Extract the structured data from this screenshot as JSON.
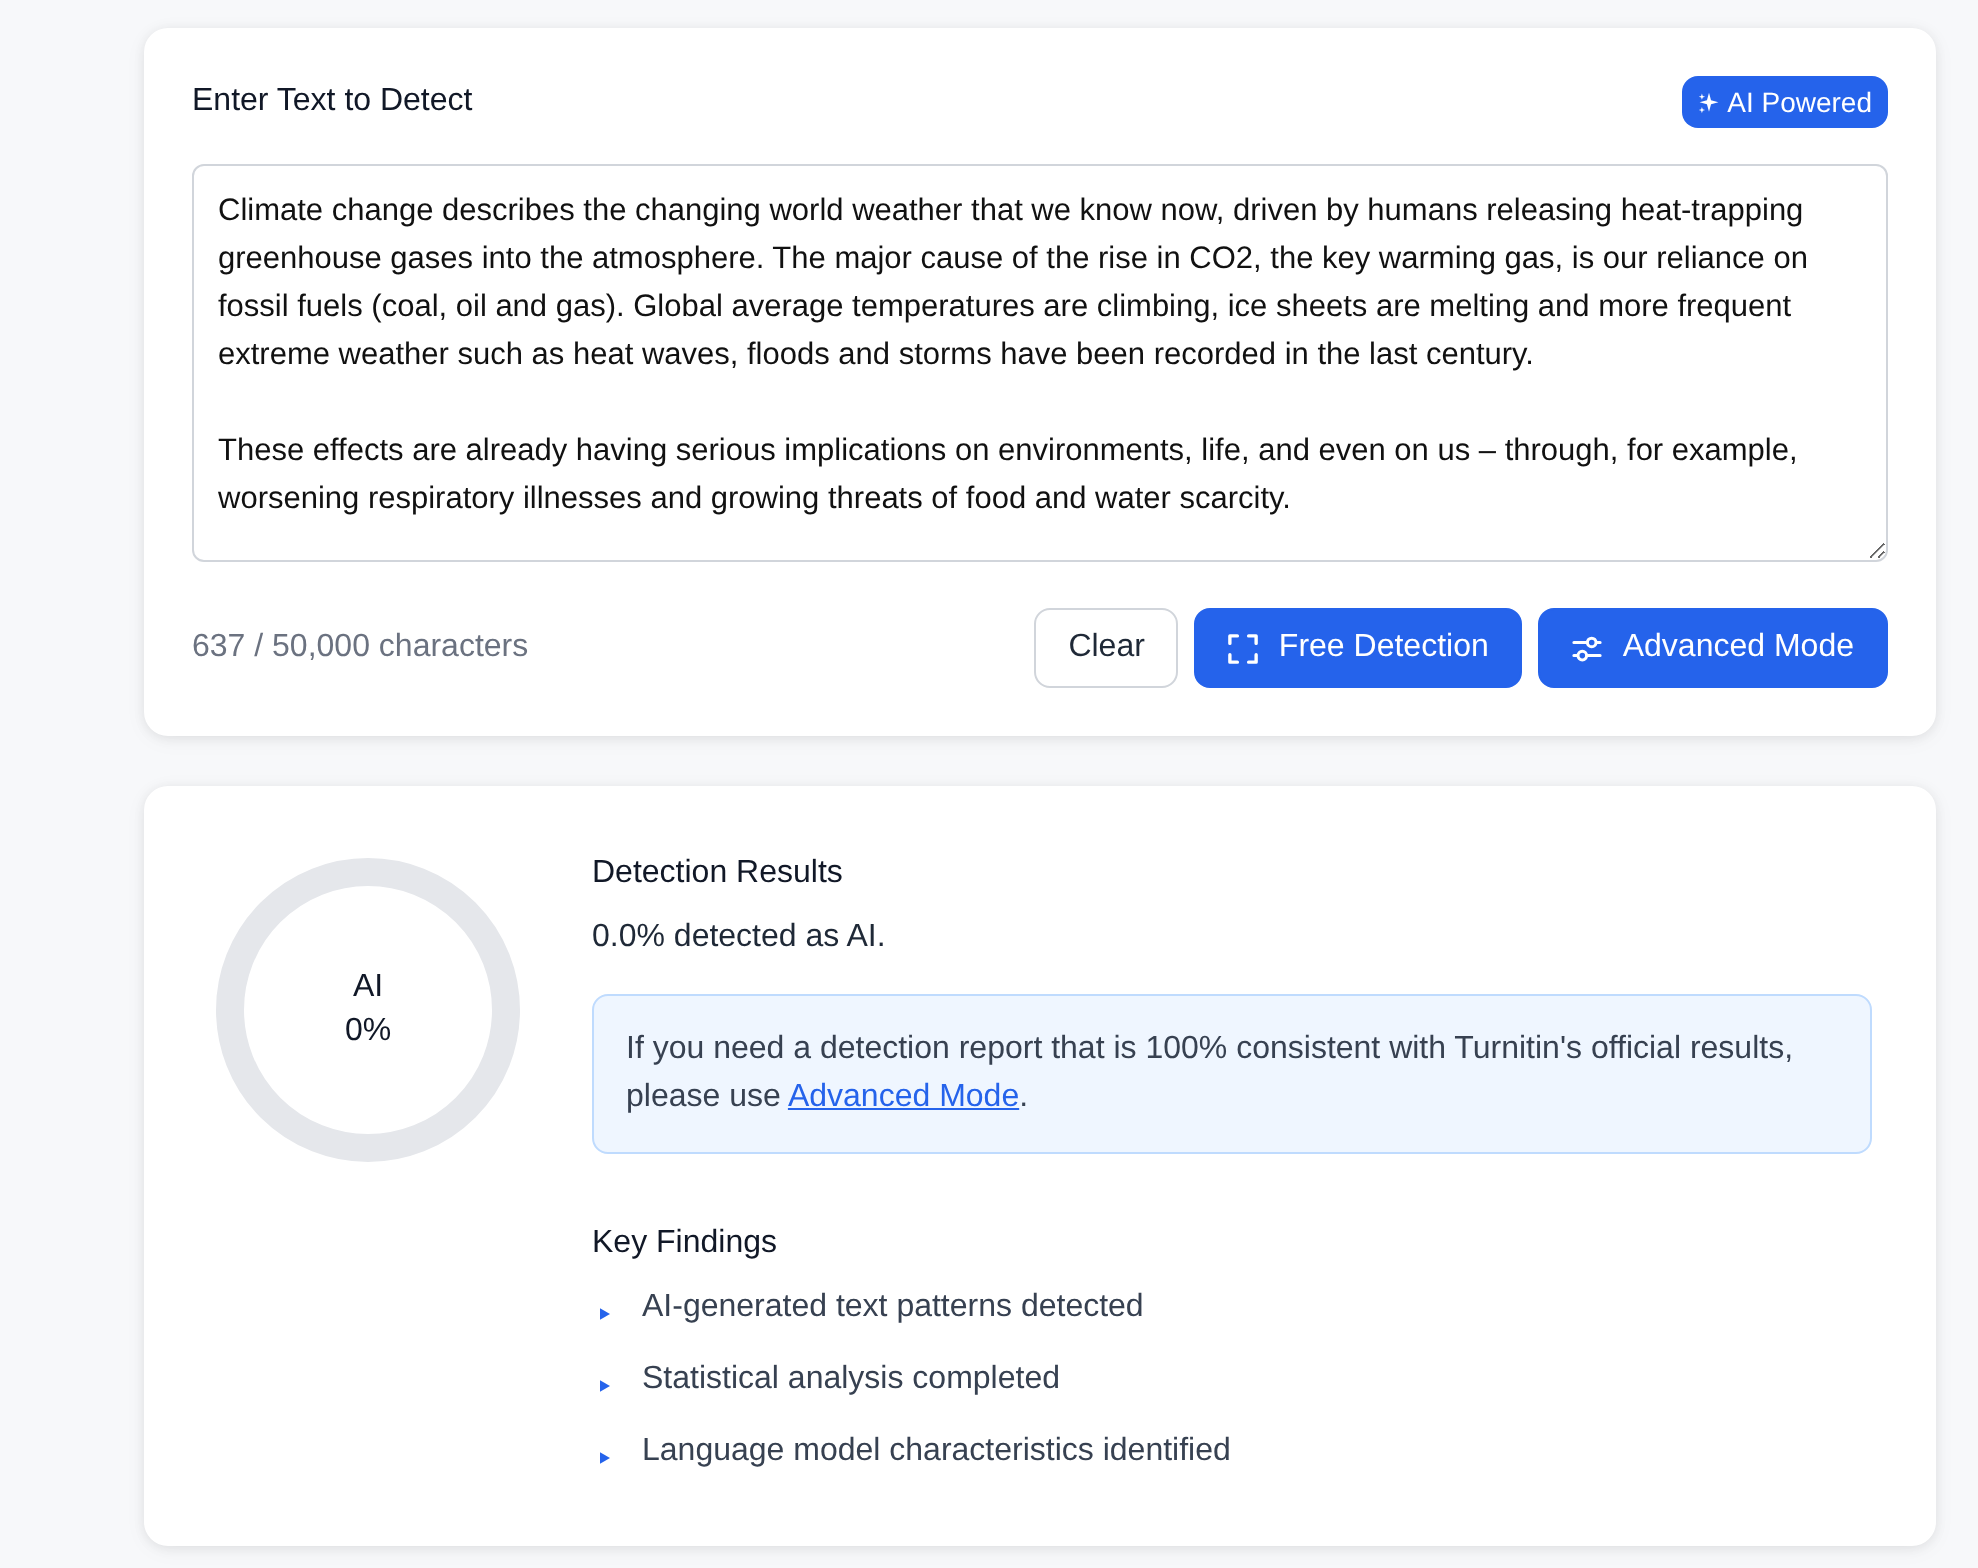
{
  "input_card": {
    "title": "Enter Text to Detect",
    "badge": "AI Powered",
    "text": "Climate change describes the changing world weather that we know now, driven by humans releasing heat-trapping greenhouse gases into the atmosphere. The major cause of the rise in CO2, the key warming gas, is our reliance on fossil fuels (coal, oil and gas). Global average temperatures are climbing, ice sheets are melting and more frequent extreme weather such as heat waves, floods and storms have been recorded in the last century.\n\nThese effects are already having serious implications on environments, life, and even on us – through, for example, worsening respiratory illnesses and growing threats of food and water scarcity.",
    "char_count": "637 / 50,000 characters",
    "buttons": [
      {
        "label": "Clear",
        "kind": "plain"
      },
      {
        "label": "Free Detection",
        "kind": "detect"
      },
      {
        "label": "Advanced Mode",
        "kind": "advanced"
      }
    ]
  },
  "results": {
    "ring": {
      "label": "AI",
      "reading": "0%",
      "level": 0
    },
    "heading": "Detection Results",
    "summary": "0.0% detected as AI.",
    "notice": {
      "text": "If you need a detection report that is 100% consistent with Turnitin's official results, please use ",
      "link": "Advanced Mode",
      "after": "."
    },
    "findings_title": "Key Findings",
    "findings": [
      "AI-generated text patterns detected",
      "Statistical analysis completed",
      "Language model characteristics identified"
    ]
  }
}
